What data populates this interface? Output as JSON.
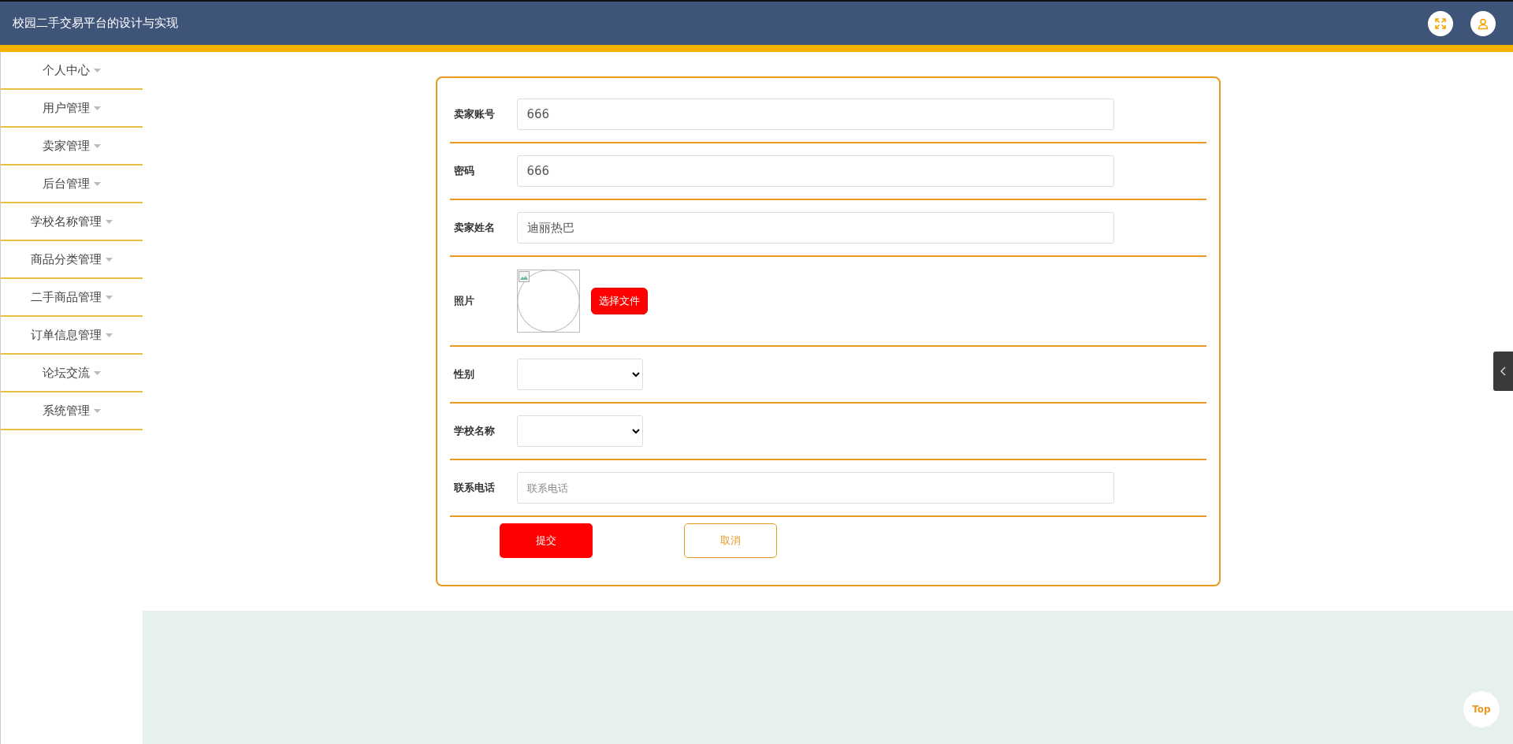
{
  "header": {
    "title": "校园二手交易平台的设计与实现"
  },
  "sidebar": {
    "items": [
      {
        "label": "个人中心",
        "expanded": false
      },
      {
        "label": "用户管理",
        "expanded": false
      },
      {
        "label": "卖家管理",
        "expanded": false
      },
      {
        "label": "后台管理",
        "expanded": false
      },
      {
        "label": "学校名称管理",
        "expanded": false
      },
      {
        "label": "商品分类管理",
        "expanded": false
      },
      {
        "label": "二手商品管理",
        "expanded": false
      },
      {
        "label": "订单信息管理",
        "expanded": false
      },
      {
        "label": "论坛交流",
        "expanded": false
      },
      {
        "label": "系统管理",
        "expanded": false
      }
    ]
  },
  "form": {
    "fields": [
      {
        "kind": "text",
        "label": "卖家账号",
        "value": "666"
      },
      {
        "kind": "text",
        "label": "密码",
        "value": "666"
      },
      {
        "kind": "text",
        "label": "卖家姓名",
        "value": "迪丽热巴"
      },
      {
        "kind": "image",
        "label": "照片",
        "button": "选择文件"
      },
      {
        "kind": "select",
        "label": "性别"
      },
      {
        "kind": "select",
        "label": "学校名称"
      },
      {
        "kind": "text",
        "label": "联系电话",
        "placeholder": "联系电话"
      }
    ],
    "submit": "提交",
    "cancel": "取消"
  },
  "back_to_top": "Top"
}
